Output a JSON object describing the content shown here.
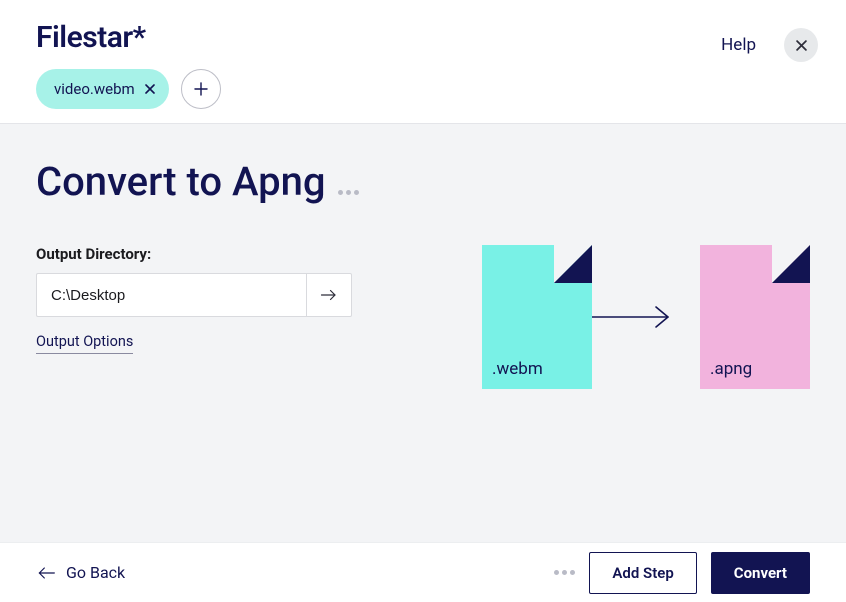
{
  "header": {
    "logo": "Filestar*",
    "help_label": "Help",
    "file_chip": {
      "name": "video.webm"
    }
  },
  "page": {
    "title": "Convert to Apng"
  },
  "form": {
    "output_directory_label": "Output Directory:",
    "output_directory_value": "C:\\Desktop",
    "output_options_label": "Output Options"
  },
  "preview": {
    "source_ext": ".webm",
    "target_ext": ".apng"
  },
  "footer": {
    "go_back_label": "Go Back",
    "add_step_label": "Add Step",
    "convert_label": "Convert"
  }
}
